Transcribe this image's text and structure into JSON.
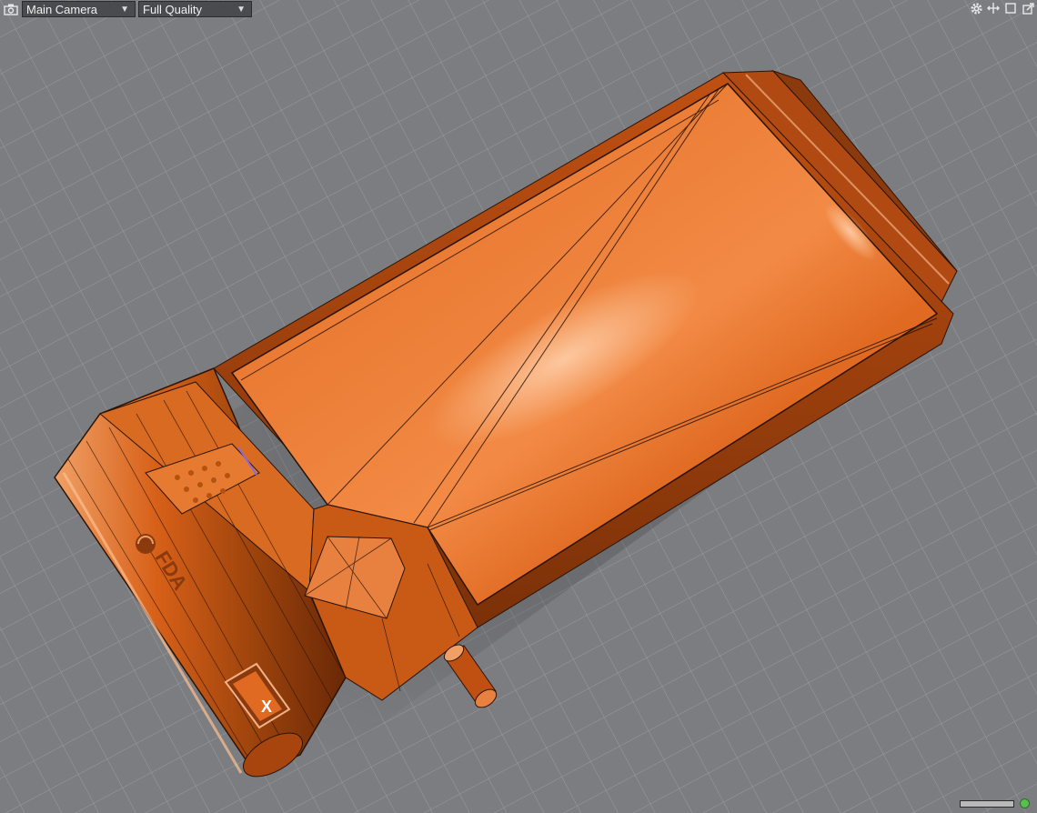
{
  "toolbar": {
    "camera_select": "Main Camera",
    "quality_select": "Full Quality",
    "camera_icon": "camera-icon"
  },
  "top_right_icons": [
    "gear-icon",
    "move-arrows-icon",
    "maximize-square-icon",
    "popout-window-icon"
  ],
  "status": {
    "progress": 1.0,
    "indicator": "ok"
  },
  "colors": {
    "background": "#7c7d80",
    "grid_line": "#9a9b9e",
    "model_orange": "#e06a22",
    "model_highlight": "#f7a36a",
    "model_shadow": "#8a3a0c",
    "wire": "#2a1408",
    "status_ok": "#58c04c"
  },
  "model": {
    "logo_text": "FDA",
    "badge_text": "X"
  }
}
